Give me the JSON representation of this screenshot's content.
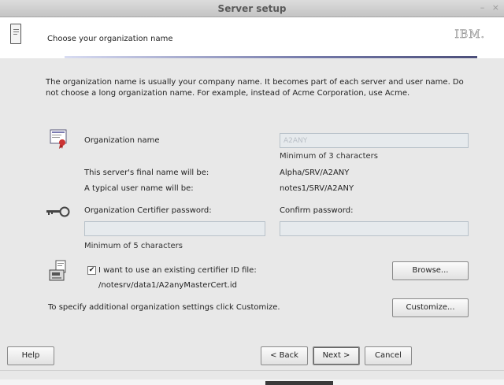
{
  "window": {
    "title": "Server setup",
    "controls": [
      "–",
      "×"
    ]
  },
  "header": {
    "step_title": "Choose your organization name",
    "logo_text": "IBM."
  },
  "main": {
    "description": "The organization name is usually your company name. It becomes part of each server and user name. Do not choose a long organization name. For example, instead of Acme Corporation, use Acme.",
    "org_name": {
      "label": "Organization name",
      "value": "A2ANY",
      "hint": "Minimum of 3 characters"
    },
    "server_name": {
      "label": "This server's final name will be:",
      "value": "Alpha/SRV/A2ANY"
    },
    "user_name": {
      "label": "A typical user name will be:",
      "value": "notes1/SRV/A2ANY"
    },
    "certifier_password": {
      "label": "Organization Certifier password:",
      "value": "",
      "hint": "Minimum of 5 characters"
    },
    "confirm_password": {
      "label": "Confirm password:",
      "value": ""
    },
    "existing_id": {
      "checked": true,
      "label": "I want to use an existing certifier ID file:",
      "path": "/notesrv/data1/A2anyMasterCert.id",
      "browse_label": "Browse..."
    },
    "customize": {
      "text": "To specify additional organization settings click Customize.",
      "button_label": "Customize..."
    }
  },
  "footer": {
    "help_label": "Help",
    "back_label": "< Back",
    "next_label": "Next >",
    "cancel_label": "Cancel"
  },
  "colors": {
    "field_bg": "#e6eaed",
    "field_text": "#b9bfc6",
    "header_rule": "#4c4f7a"
  },
  "icons": [
    "document-icon",
    "certificate-icon",
    "key-icon",
    "id-file-icon"
  ]
}
